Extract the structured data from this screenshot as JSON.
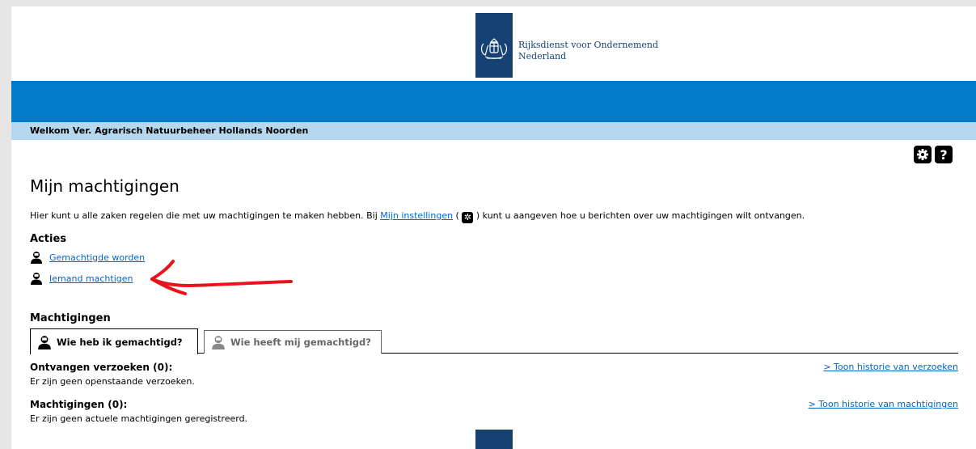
{
  "header": {
    "org_line1": "Rijksdienst voor Ondernemend",
    "org_line2": "Nederland",
    "logo_icon": "coat-of-arms-icon",
    "brand_color": "#154273",
    "bar_color": "#007bc7"
  },
  "welcome": "Welkom Ver. Agrarisch Natuurbeheer Hollands Noorden",
  "tools": {
    "settings_icon": "gear-icon",
    "help_label": "?"
  },
  "page_title": "Mijn machtigingen",
  "intro": {
    "before": "Hier kunt u alle zaken regelen die met uw machtigingen te maken hebben. Bij ",
    "link": "Mijn instellingen",
    "paren_open": " ( ",
    "paren_close": " ) ",
    "after": "kunt u aangeven hoe u berichten over uw machtigingen wilt ontvangen."
  },
  "acties": {
    "heading": "Acties",
    "items": [
      {
        "label": "Gemachtigde worden",
        "icon": "person-icon"
      },
      {
        "label": "Iemand machtigen",
        "icon": "person-icon"
      }
    ]
  },
  "machtigingen": {
    "heading": "Machtigingen",
    "tabs": [
      {
        "label": "Wie heb ik gemachtigd?",
        "active": true
      },
      {
        "label": "Wie heeft mij gemachtigd?",
        "active": false
      }
    ],
    "sections": [
      {
        "title": "Ontvangen verzoeken (0):",
        "text": "Er zijn geen openstaande verzoeken.",
        "link": "> Toon historie van verzoeken"
      },
      {
        "title": "Machtigingen (0):",
        "text": "Er zijn geen actuele machtigingen geregistreerd.",
        "link": "> Toon historie van machtigingen"
      }
    ]
  },
  "annotation_color": "#e8141b"
}
